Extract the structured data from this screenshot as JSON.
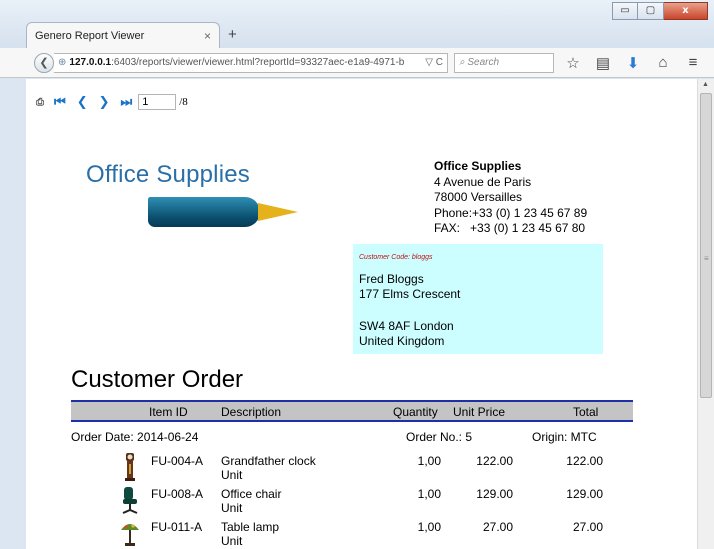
{
  "window": {
    "tab_title": "Genero Report Viewer",
    "tab_close": "×",
    "new_tab": "+",
    "controls": {
      "minimize": "▭",
      "maximize": "▢",
      "close": "x"
    }
  },
  "navbar": {
    "back": "❮",
    "url_host": "127.0.0.1",
    "url_path": ":6403/reports/viewer/viewer.html?reportId=93327aec-e1a9-4971-b",
    "url_tail": "▽ C",
    "search_placeholder": "Search",
    "icons": [
      "star-icon",
      "reader-icon",
      "download-icon",
      "home-icon",
      "menu-icon"
    ]
  },
  "report_toolbar": {
    "page_current": "1",
    "page_total": "/8"
  },
  "logo": {
    "text": "Office Supplies"
  },
  "company": {
    "name": "Office Supplies",
    "street": "4 Avenue de Paris",
    "city": "78000 Versailles",
    "phone": "Phone:+33 (0) 1 23 45 67 89",
    "fax": "FAX:   +33 (0) 1 23 45 67 80"
  },
  "customer": {
    "code_label": "Customer Code:  bloggs",
    "name": "Fred Bloggs",
    "street": "177 Elms Crescent",
    "postcode_city": "SW4 8AF London",
    "country": "United Kingdom"
  },
  "order": {
    "title": "Customer Order",
    "columns": [
      "Item ID",
      "Description",
      "Quantity",
      "Unit Price",
      "Total"
    ],
    "order_date": "Order Date: 2014-06-24",
    "order_no": "Order No.: 5",
    "origin": "Origin: MTC",
    "rows": [
      {
        "icon": "grandfather-clock-icon",
        "id": "FU-004-A",
        "desc": "Grandfather clock",
        "unit": "Unit",
        "qty": "1,00",
        "price": "122.00",
        "total": "122.00"
      },
      {
        "icon": "office-chair-icon",
        "id": "FU-008-A",
        "desc": "Office chair",
        "unit": "Unit",
        "qty": "1,00",
        "price": "129.00",
        "total": "129.00"
      },
      {
        "icon": "table-lamp-icon",
        "id": "FU-011-A",
        "desc": "Table lamp",
        "unit": "Unit",
        "qty": "1,00",
        "price": "27.00",
        "total": "27.00"
      }
    ]
  },
  "colors": {
    "accent_blue": "#1a73c8",
    "table_rule": "#1f2fa8",
    "customer_bg": "#ccfeff",
    "logo_blue": "#2a6fa8"
  }
}
